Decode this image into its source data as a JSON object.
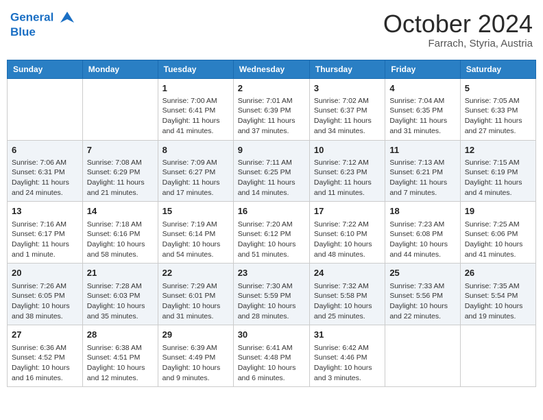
{
  "header": {
    "logo_line1": "General",
    "logo_line2": "Blue",
    "month": "October 2024",
    "location": "Farrach, Styria, Austria"
  },
  "days_of_week": [
    "Sunday",
    "Monday",
    "Tuesday",
    "Wednesday",
    "Thursday",
    "Friday",
    "Saturday"
  ],
  "weeks": [
    [
      {
        "day": "",
        "sunrise": "",
        "sunset": "",
        "daylight": ""
      },
      {
        "day": "",
        "sunrise": "",
        "sunset": "",
        "daylight": ""
      },
      {
        "day": "1",
        "sunrise": "Sunrise: 7:00 AM",
        "sunset": "Sunset: 6:41 PM",
        "daylight": "Daylight: 11 hours and 41 minutes."
      },
      {
        "day": "2",
        "sunrise": "Sunrise: 7:01 AM",
        "sunset": "Sunset: 6:39 PM",
        "daylight": "Daylight: 11 hours and 37 minutes."
      },
      {
        "day": "3",
        "sunrise": "Sunrise: 7:02 AM",
        "sunset": "Sunset: 6:37 PM",
        "daylight": "Daylight: 11 hours and 34 minutes."
      },
      {
        "day": "4",
        "sunrise": "Sunrise: 7:04 AM",
        "sunset": "Sunset: 6:35 PM",
        "daylight": "Daylight: 11 hours and 31 minutes."
      },
      {
        "day": "5",
        "sunrise": "Sunrise: 7:05 AM",
        "sunset": "Sunset: 6:33 PM",
        "daylight": "Daylight: 11 hours and 27 minutes."
      }
    ],
    [
      {
        "day": "6",
        "sunrise": "Sunrise: 7:06 AM",
        "sunset": "Sunset: 6:31 PM",
        "daylight": "Daylight: 11 hours and 24 minutes."
      },
      {
        "day": "7",
        "sunrise": "Sunrise: 7:08 AM",
        "sunset": "Sunset: 6:29 PM",
        "daylight": "Daylight: 11 hours and 21 minutes."
      },
      {
        "day": "8",
        "sunrise": "Sunrise: 7:09 AM",
        "sunset": "Sunset: 6:27 PM",
        "daylight": "Daylight: 11 hours and 17 minutes."
      },
      {
        "day": "9",
        "sunrise": "Sunrise: 7:11 AM",
        "sunset": "Sunset: 6:25 PM",
        "daylight": "Daylight: 11 hours and 14 minutes."
      },
      {
        "day": "10",
        "sunrise": "Sunrise: 7:12 AM",
        "sunset": "Sunset: 6:23 PM",
        "daylight": "Daylight: 11 hours and 11 minutes."
      },
      {
        "day": "11",
        "sunrise": "Sunrise: 7:13 AM",
        "sunset": "Sunset: 6:21 PM",
        "daylight": "Daylight: 11 hours and 7 minutes."
      },
      {
        "day": "12",
        "sunrise": "Sunrise: 7:15 AM",
        "sunset": "Sunset: 6:19 PM",
        "daylight": "Daylight: 11 hours and 4 minutes."
      }
    ],
    [
      {
        "day": "13",
        "sunrise": "Sunrise: 7:16 AM",
        "sunset": "Sunset: 6:17 PM",
        "daylight": "Daylight: 11 hours and 1 minute."
      },
      {
        "day": "14",
        "sunrise": "Sunrise: 7:18 AM",
        "sunset": "Sunset: 6:16 PM",
        "daylight": "Daylight: 10 hours and 58 minutes."
      },
      {
        "day": "15",
        "sunrise": "Sunrise: 7:19 AM",
        "sunset": "Sunset: 6:14 PM",
        "daylight": "Daylight: 10 hours and 54 minutes."
      },
      {
        "day": "16",
        "sunrise": "Sunrise: 7:20 AM",
        "sunset": "Sunset: 6:12 PM",
        "daylight": "Daylight: 10 hours and 51 minutes."
      },
      {
        "day": "17",
        "sunrise": "Sunrise: 7:22 AM",
        "sunset": "Sunset: 6:10 PM",
        "daylight": "Daylight: 10 hours and 48 minutes."
      },
      {
        "day": "18",
        "sunrise": "Sunrise: 7:23 AM",
        "sunset": "Sunset: 6:08 PM",
        "daylight": "Daylight: 10 hours and 44 minutes."
      },
      {
        "day": "19",
        "sunrise": "Sunrise: 7:25 AM",
        "sunset": "Sunset: 6:06 PM",
        "daylight": "Daylight: 10 hours and 41 minutes."
      }
    ],
    [
      {
        "day": "20",
        "sunrise": "Sunrise: 7:26 AM",
        "sunset": "Sunset: 6:05 PM",
        "daylight": "Daylight: 10 hours and 38 minutes."
      },
      {
        "day": "21",
        "sunrise": "Sunrise: 7:28 AM",
        "sunset": "Sunset: 6:03 PM",
        "daylight": "Daylight: 10 hours and 35 minutes."
      },
      {
        "day": "22",
        "sunrise": "Sunrise: 7:29 AM",
        "sunset": "Sunset: 6:01 PM",
        "daylight": "Daylight: 10 hours and 31 minutes."
      },
      {
        "day": "23",
        "sunrise": "Sunrise: 7:30 AM",
        "sunset": "Sunset: 5:59 PM",
        "daylight": "Daylight: 10 hours and 28 minutes."
      },
      {
        "day": "24",
        "sunrise": "Sunrise: 7:32 AM",
        "sunset": "Sunset: 5:58 PM",
        "daylight": "Daylight: 10 hours and 25 minutes."
      },
      {
        "day": "25",
        "sunrise": "Sunrise: 7:33 AM",
        "sunset": "Sunset: 5:56 PM",
        "daylight": "Daylight: 10 hours and 22 minutes."
      },
      {
        "day": "26",
        "sunrise": "Sunrise: 7:35 AM",
        "sunset": "Sunset: 5:54 PM",
        "daylight": "Daylight: 10 hours and 19 minutes."
      }
    ],
    [
      {
        "day": "27",
        "sunrise": "Sunrise: 6:36 AM",
        "sunset": "Sunset: 4:52 PM",
        "daylight": "Daylight: 10 hours and 16 minutes."
      },
      {
        "day": "28",
        "sunrise": "Sunrise: 6:38 AM",
        "sunset": "Sunset: 4:51 PM",
        "daylight": "Daylight: 10 hours and 12 minutes."
      },
      {
        "day": "29",
        "sunrise": "Sunrise: 6:39 AM",
        "sunset": "Sunset: 4:49 PM",
        "daylight": "Daylight: 10 hours and 9 minutes."
      },
      {
        "day": "30",
        "sunrise": "Sunrise: 6:41 AM",
        "sunset": "Sunset: 4:48 PM",
        "daylight": "Daylight: 10 hours and 6 minutes."
      },
      {
        "day": "31",
        "sunrise": "Sunrise: 6:42 AM",
        "sunset": "Sunset: 4:46 PM",
        "daylight": "Daylight: 10 hours and 3 minutes."
      },
      {
        "day": "",
        "sunrise": "",
        "sunset": "",
        "daylight": ""
      },
      {
        "day": "",
        "sunrise": "",
        "sunset": "",
        "daylight": ""
      }
    ]
  ]
}
